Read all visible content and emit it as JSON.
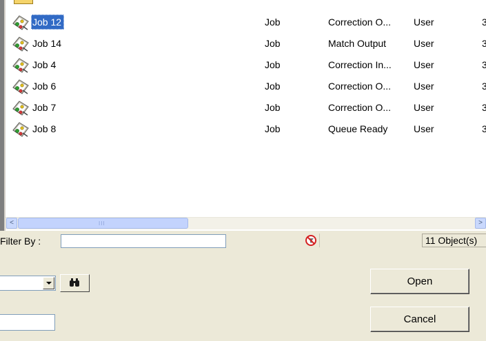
{
  "list": {
    "rows": [
      {
        "name": "Job 12",
        "type": "Job",
        "status": "Correction O...",
        "owner": "User",
        "extra": "3",
        "selected": true
      },
      {
        "name": "Job 14",
        "type": "Job",
        "status": "Match Output",
        "owner": "User",
        "extra": "3",
        "selected": false
      },
      {
        "name": "Job 4",
        "type": "Job",
        "status": "Correction In...",
        "owner": "User",
        "extra": "3",
        "selected": false
      },
      {
        "name": "Job 6",
        "type": "Job",
        "status": "Correction O...",
        "owner": "User",
        "extra": "3",
        "selected": false
      },
      {
        "name": "Job 7",
        "type": "Job",
        "status": "Correction O...",
        "owner": "User",
        "extra": "3",
        "selected": false
      },
      {
        "name": "Job 8",
        "type": "Job",
        "status": "Queue Ready",
        "owner": "User",
        "extra": "3",
        "selected": false
      }
    ],
    "row_icon": "job-icon",
    "selection_color": "#316ac5"
  },
  "scrollbar": {
    "left_arrow": "<",
    "right_arrow": ">",
    "grip": "III"
  },
  "filter": {
    "label": "Filter By :",
    "value": "",
    "clear_icon": "clear-filter-icon",
    "object_count": "11 Object(s)"
  },
  "controls": {
    "dropdown_value": "",
    "find_icon": "binoculars-icon",
    "text_value": "",
    "open_label": "Open",
    "cancel_label": "Cancel"
  }
}
